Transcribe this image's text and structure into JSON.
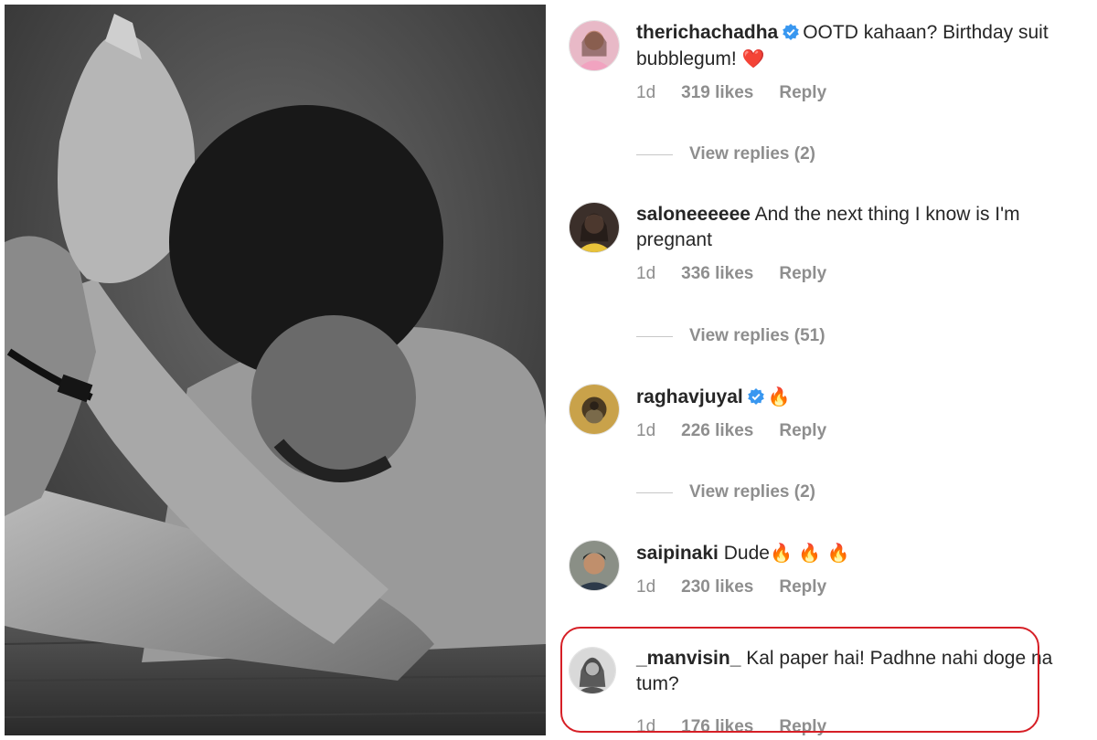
{
  "comments": [
    {
      "username": "therichachadha",
      "verified": true,
      "text": "OOTD kahaan? Birthday suit bubblegum!",
      "emoji": "❤️",
      "time": "1d",
      "likes": "319 likes",
      "reply": "Reply",
      "view_replies": "View replies (2)"
    },
    {
      "username": "saloneeeeee",
      "verified": false,
      "text": "And the next thing I know is I'm pregnant",
      "time": "1d",
      "likes": "336 likes",
      "reply": "Reply",
      "view_replies": "View replies (51)"
    },
    {
      "username": "raghavjuyal",
      "verified": true,
      "text": "",
      "emoji": "🔥",
      "time": "1d",
      "likes": "226 likes",
      "reply": "Reply",
      "view_replies": "View replies (2)"
    },
    {
      "username": "saipinaki",
      "verified": false,
      "text": "Dude",
      "emoji": "🔥 🔥 🔥",
      "time": "1d",
      "likes": "230 likes",
      "reply": "Reply"
    },
    {
      "username": "_manvisin_",
      "verified": false,
      "text": "Kal paper hai! Padhne nahi doge na tum?",
      "time": "1d",
      "likes": "176 likes",
      "reply": "Reply"
    }
  ],
  "colors": {
    "verified": "#3897f0",
    "highlight": "#d61f26",
    "muted": "#8e8e8e"
  }
}
